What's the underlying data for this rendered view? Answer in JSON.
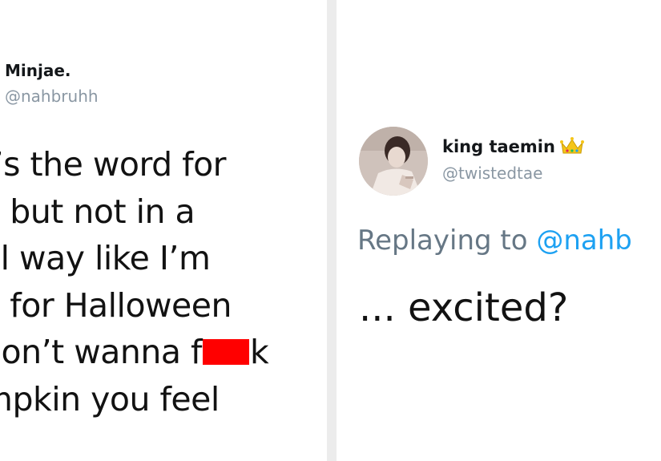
{
  "left_tweet": {
    "display_name": "Minjae.",
    "handle": "@nahbruhh",
    "body_lines": [
      "t’s the word for",
      "y but not in a",
      "al way like I’m",
      "y for Halloween",
      "don’t wanna f",
      "mpkin you feel"
    ],
    "body_line5_tail": "k"
  },
  "right_tweet": {
    "display_name": "king taemin",
    "handle": "@twistedtae",
    "reply_prefix": "Replaying to ",
    "reply_mention": "@nahb",
    "body": "... excited?",
    "name_emoji_icon": "crown-icon"
  },
  "colors": {
    "divider": "#ececec",
    "mention": "#1da1f2",
    "redaction": "#ff0000",
    "handle": "#8a97a3"
  }
}
